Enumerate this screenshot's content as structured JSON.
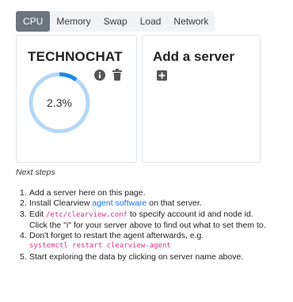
{
  "tabs": [
    {
      "label": "CPU",
      "active": true
    },
    {
      "label": "Memory",
      "active": false
    },
    {
      "label": "Swap",
      "active": false
    },
    {
      "label": "Load",
      "active": false
    },
    {
      "label": "Network",
      "active": false
    }
  ],
  "server_card": {
    "name": "TECHNOCHAT",
    "value_text": "2.3%",
    "value_fraction": 0.023,
    "icons": [
      "info-icon",
      "trash-icon"
    ]
  },
  "add_card": {
    "title": "Add a server",
    "icon": "plus-square-icon"
  },
  "next_steps": {
    "title": "Next steps",
    "step1": "Add a server here on this page.",
    "step2_pre": "Install Clearview ",
    "step2_link": "agent software",
    "step2_post": " on that server.",
    "step3_pre": "Edit ",
    "step3_code": "/etc/clearview.conf",
    "step3_post": " to specify account id and node id.",
    "step3_line2": "Click the \"i\" for your server above to find out what to set them to.",
    "step4": "Don't forget to restart the agent afterwards, e.g.",
    "step4_code": "systemctl restart clearview-agent",
    "step5": "Start exploring the data by clicking on server name above."
  },
  "colors": {
    "tab_active_bg": "#6c757d",
    "gauge_track": "#b3d8f5",
    "gauge_fill": "#1e88e5",
    "link": "#1a73e8",
    "code": "#d63384"
  }
}
